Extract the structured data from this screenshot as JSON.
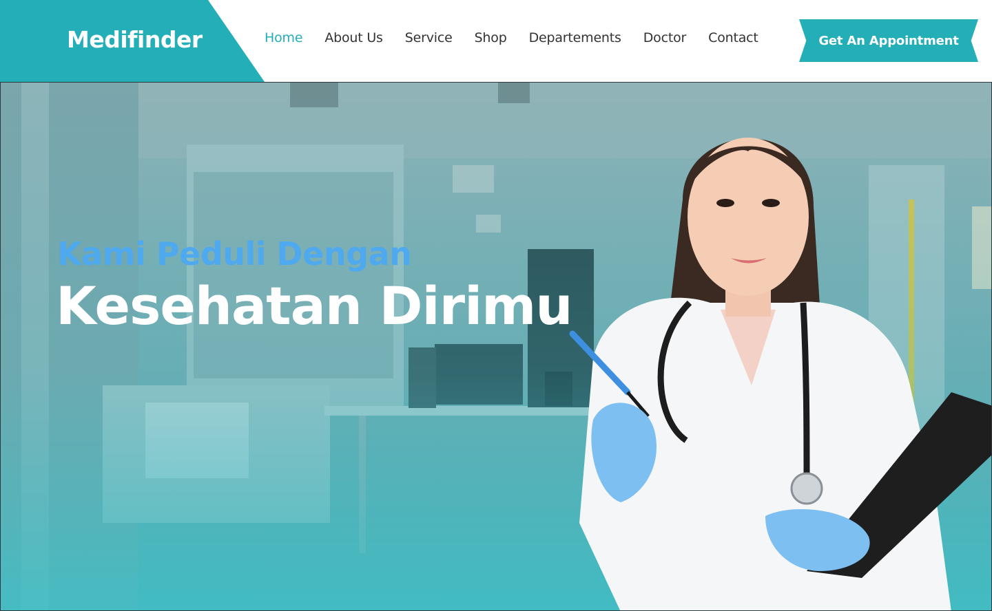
{
  "brand": {
    "name": "Medifinder",
    "color": "#24aeb8"
  },
  "nav": {
    "items": [
      {
        "label": "Home",
        "active": true
      },
      {
        "label": "About Us",
        "active": false
      },
      {
        "label": "Service",
        "active": false
      },
      {
        "label": "Shop",
        "active": false
      },
      {
        "label": "Departements",
        "active": false
      },
      {
        "label": "Doctor",
        "active": false
      },
      {
        "label": "Contact",
        "active": false
      }
    ],
    "cta_label": "Get  An Appointment"
  },
  "hero": {
    "subtitle": "Kami Peduli Dengan",
    "title": "Kesehatan Dirimu",
    "subtitle_color": "#4fa9ee",
    "title_color": "#ffffff"
  }
}
